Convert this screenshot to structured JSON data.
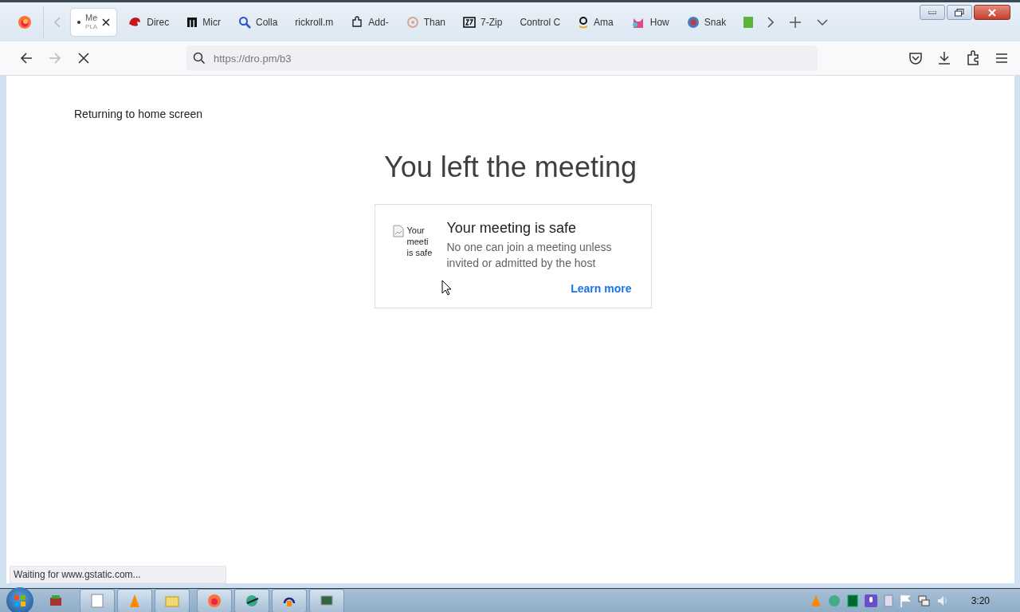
{
  "tabs": [
    {
      "label": "Me",
      "sublabel": "PLA",
      "selected": true
    },
    {
      "label": "Direc",
      "selected": false
    },
    {
      "label": "Micr",
      "selected": false
    },
    {
      "label": "Colla",
      "selected": false
    },
    {
      "label": "rickroll.m",
      "selected": false
    },
    {
      "label": "Add-",
      "selected": false
    },
    {
      "label": "Than",
      "selected": false
    },
    {
      "label": "7-Zip",
      "selected": false
    },
    {
      "label": "Control C",
      "selected": false
    },
    {
      "label": "Ama",
      "selected": false
    },
    {
      "label": "How",
      "selected": false
    },
    {
      "label": "Snak",
      "selected": false
    },
    {
      "selected": false
    }
  ],
  "address": {
    "url": "https://dro.pm/b3"
  },
  "page": {
    "back_link": "Returning to home screen",
    "heading": "You left the meeting",
    "card": {
      "image_alt": "Your meeti is safe",
      "title": "Your meeting is safe",
      "text": "No one can join a meeting unless invited or admitted by the host",
      "link": "Learn more"
    }
  },
  "status_bar": "Waiting for www.gstatic.com...",
  "taskbar": {
    "clock": "3:20"
  }
}
